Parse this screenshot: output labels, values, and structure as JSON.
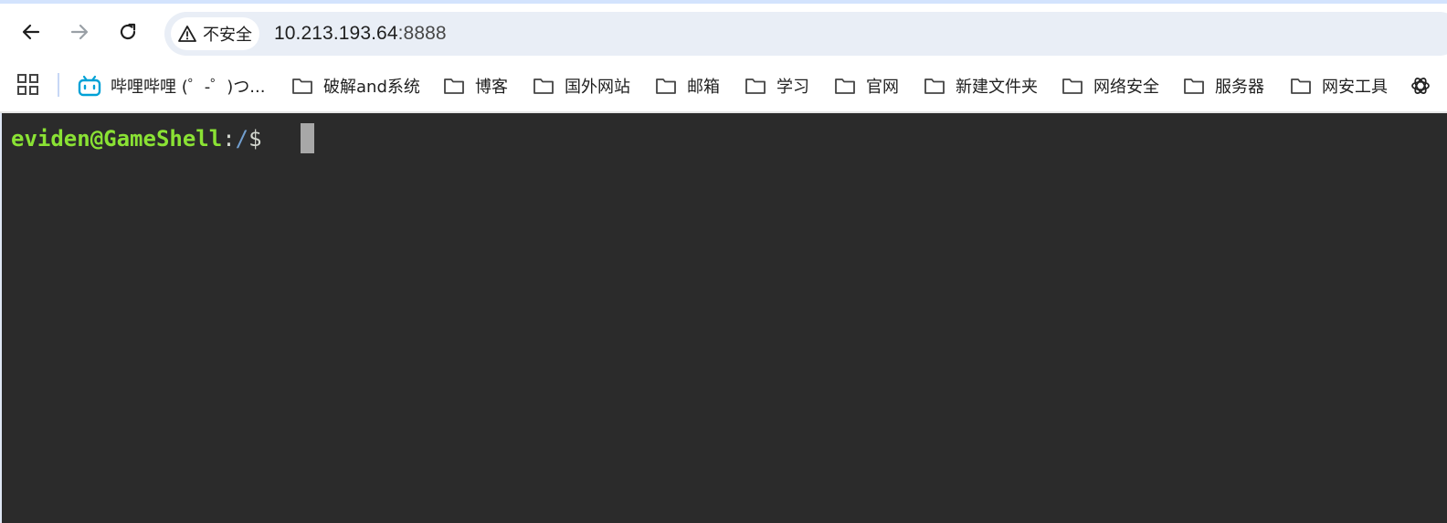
{
  "browser": {
    "security_label": "不安全",
    "url_host": "10.213.193.64",
    "url_port": ":8888"
  },
  "bookmarks": [
    {
      "label": "哔哩哔哩 (゜-゜)つ...",
      "icon": "bilibili-icon"
    },
    {
      "label": "破解and系统",
      "icon": "folder-icon"
    },
    {
      "label": "博客",
      "icon": "folder-icon"
    },
    {
      "label": "国外网站",
      "icon": "folder-icon"
    },
    {
      "label": "邮箱",
      "icon": "folder-icon"
    },
    {
      "label": "学习",
      "icon": "folder-icon"
    },
    {
      "label": "官网",
      "icon": "folder-icon"
    },
    {
      "label": "新建文件夹",
      "icon": "folder-icon"
    },
    {
      "label": "网络安全",
      "icon": "folder-icon"
    },
    {
      "label": "服务器",
      "icon": "folder-icon"
    },
    {
      "label": "网安工具",
      "icon": "folder-icon"
    }
  ],
  "terminal": {
    "user_host": "eviden@GameShell",
    "colon": ":",
    "path": "/",
    "dollar": "$"
  },
  "colors": {
    "terminal_bg": "#2b2b2b",
    "prompt_user": "#8ae234",
    "prompt_path": "#729fcf",
    "omnibox_bg": "#e9eef6",
    "bilibili_blue": "#00a1d6"
  }
}
